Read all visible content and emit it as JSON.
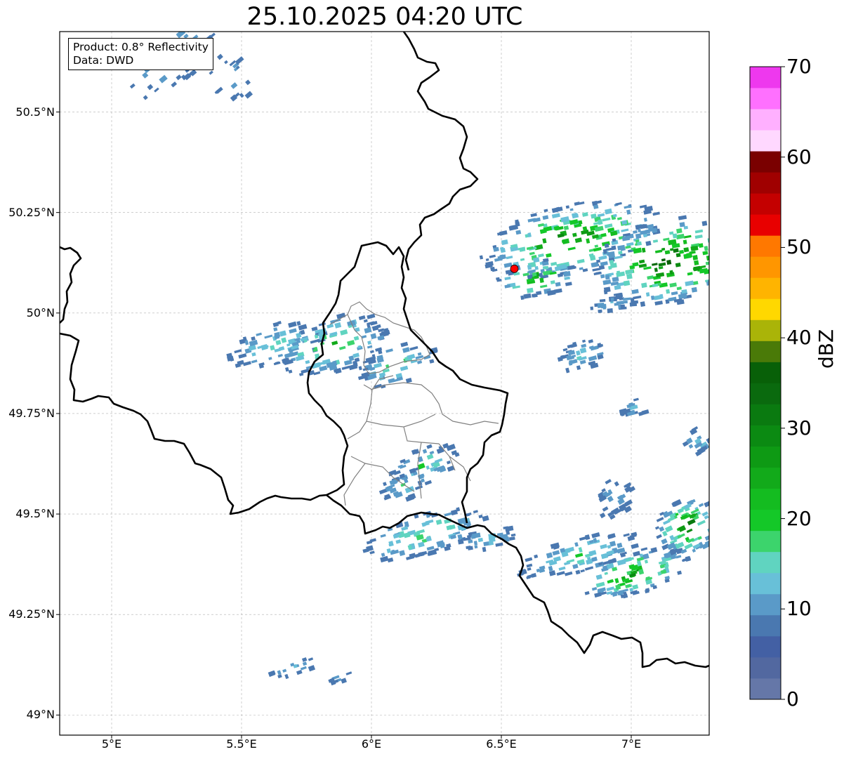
{
  "title": "25.10.2025 04:20 UTC",
  "info": {
    "product": "Product: 0.8° Reflectivity",
    "source": "Data: DWD"
  },
  "axes": {
    "x_ticks": [
      "5°E",
      "5.5°E",
      "6°E",
      "6.5°E",
      "7°E"
    ],
    "y_ticks": [
      "50.5°N",
      "50.25°N",
      "50°N",
      "49.75°N",
      "49.5°N",
      "49.25°N",
      "49°N"
    ],
    "x_range": [
      4.8,
      7.3
    ],
    "y_range": [
      48.95,
      50.7
    ]
  },
  "colorbar": {
    "label": "dBZ",
    "ticks": [
      "70",
      "60",
      "50",
      "40",
      "30",
      "20",
      "10",
      "0"
    ],
    "range": [
      0,
      70
    ],
    "colors": [
      "#6577a8",
      "#5268a0",
      "#4360a4",
      "#4a78b0",
      "#5a9ac8",
      "#68c0d8",
      "#60d4c0",
      "#3cd46c",
      "#14c828",
      "#14bc20",
      "#12aa1a",
      "#0e9a14",
      "#0b8a12",
      "#0a7a10",
      "#0a6a0e",
      "#086008",
      "#4a7a08",
      "#aab408",
      "#ffd800",
      "#ffb400",
      "#ff9600",
      "#ff7800",
      "#e80000",
      "#c40000",
      "#a00000",
      "#7a0000",
      "#ffd8ff",
      "#ffb0ff",
      "#ff70ff",
      "#ee38ee"
    ]
  },
  "marker": {
    "lon": 6.55,
    "lat": 50.11,
    "color": "#ff0000"
  },
  "colors": {
    "border": "#000000",
    "admin": "#808080",
    "grid": "#b0b0b0"
  }
}
